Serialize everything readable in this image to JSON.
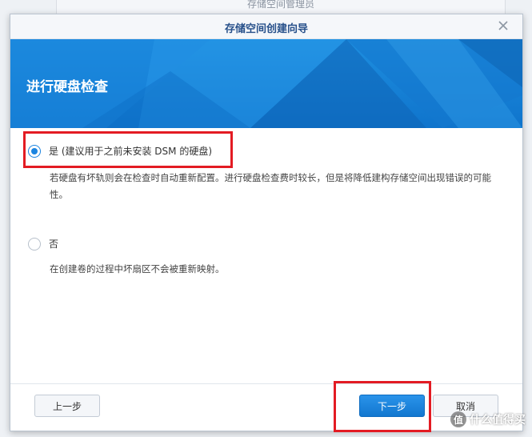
{
  "background_window": {
    "title": "存储空间管理员"
  },
  "dialog": {
    "title": "存储空间创建向导",
    "banner_title": "进行硬盘检查",
    "options": [
      {
        "label": "是 (建议用于之前未安装 DSM 的硬盘)",
        "checked": true,
        "description": "若硬盘有坏轨则会在检查时自动重新配置。进行硬盘检查费时较长，但是将降低建构存储空间出现错误的可能性。"
      },
      {
        "label": "否",
        "checked": false,
        "description": "在创建卷的过程中坏扇区不会被重新映射。"
      }
    ],
    "buttons": {
      "prev": "上一步",
      "next": "下一步",
      "cancel": "取消"
    }
  },
  "watermark": {
    "text": "什么值得买",
    "icon": "值"
  },
  "colors": {
    "accent": "#1b84e0",
    "banner": "#0f74cc",
    "highlight": "#e31b23"
  }
}
